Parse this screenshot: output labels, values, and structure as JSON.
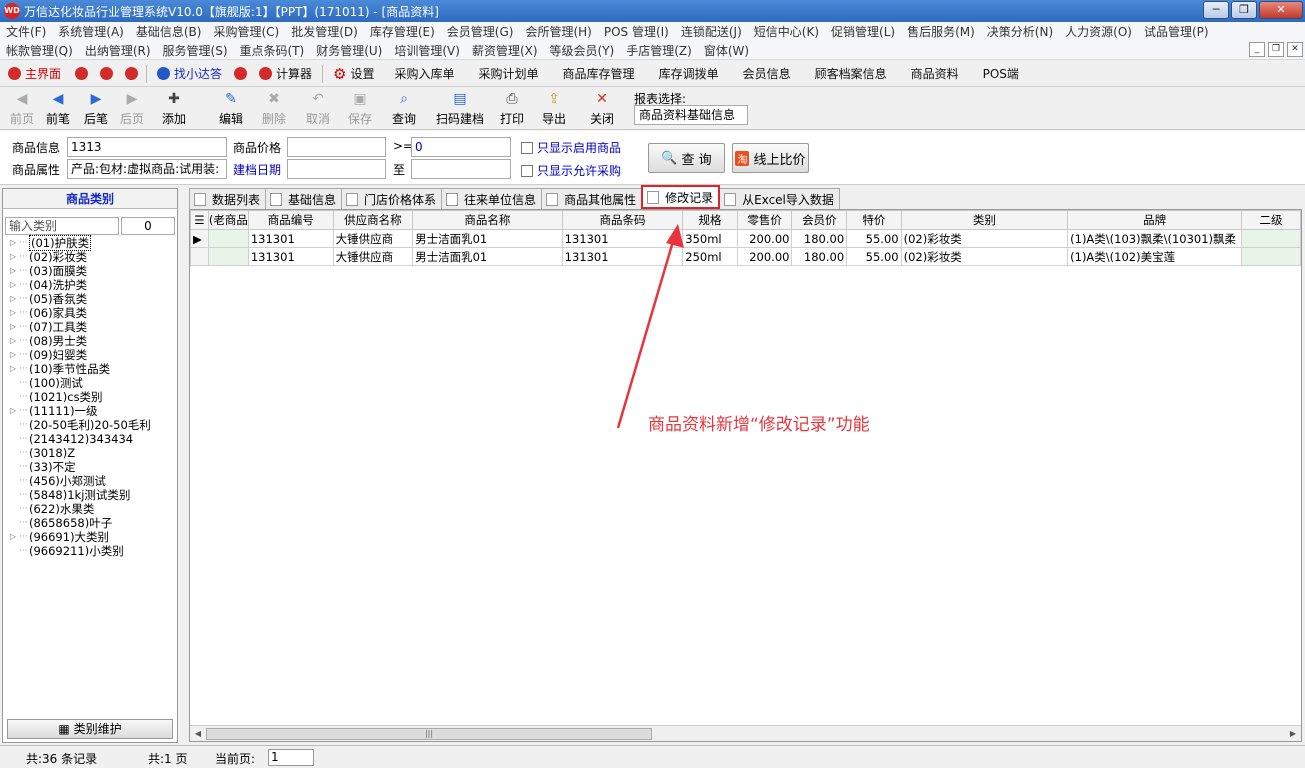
{
  "window": {
    "title": "万信达化妆品行业管理系统V10.0【旗舰版:1】【PPT】(171011) - [商品资料]",
    "logo_text": "WD"
  },
  "menu": {
    "row1": [
      "文件(F)",
      "系统管理(A)",
      "基础信息(B)",
      "采购管理(C)",
      "批发管理(D)",
      "库存管理(E)",
      "会员管理(G)",
      "会所管理(H)",
      "POS 管理(I)",
      "连锁配送(J)",
      "短信中心(K)",
      "促销管理(L)",
      "售后服务(M)",
      "决策分析(N)",
      "人力资源(O)",
      "试品管理(P)"
    ],
    "row2": [
      "帐款管理(Q)",
      "出纳管理(R)",
      "服务管理(S)",
      "重点条码(T)",
      "财务管理(U)",
      "培训管理(V)",
      "薪资管理(X)",
      "等级会员(Y)",
      "手店管理(Z)",
      "窗体(W)"
    ]
  },
  "quickbar": {
    "main": "主界面",
    "find": "找小达答",
    "calc": "计算器",
    "settings": "设置",
    "links": [
      "采购入库单",
      "采购计划单",
      "商品库存管理",
      "库存调拨单",
      "会员信息",
      "顾客档案信息",
      "商品资料",
      "POS端"
    ]
  },
  "toolbar": {
    "buttons": [
      {
        "label": "前页",
        "disabled": true
      },
      {
        "label": "前笔",
        "disabled": false
      },
      {
        "label": "后笔",
        "disabled": false
      },
      {
        "label": "后页",
        "disabled": true
      },
      {
        "label": "添加",
        "disabled": false
      },
      {
        "label": "编辑",
        "disabled": false
      },
      {
        "label": "删除",
        "disabled": true
      },
      {
        "label": "取消",
        "disabled": true
      },
      {
        "label": "保存",
        "disabled": true
      },
      {
        "label": "查询",
        "disabled": false
      },
      {
        "label": "扫码建档",
        "disabled": false
      },
      {
        "label": "打印",
        "disabled": false
      },
      {
        "label": "导出",
        "disabled": false
      },
      {
        "label": "关闭",
        "disabled": false
      }
    ],
    "report_label": "报表选择:",
    "report_value": "商品资料基础信息"
  },
  "filter": {
    "product_info_label": "商品信息",
    "product_info_value": "1313",
    "product_attr_label": "商品属性",
    "product_attr_value": "产品:包材:虚拟商品:试用装:",
    "price_label": "商品价格",
    "price_op": ">=",
    "price_value": "0",
    "date_label": "建档日期",
    "date_to": "至",
    "only_enabled": "只显示启用商品",
    "only_purchase": "只显示允许采购",
    "query_btn": "查  询",
    "compare_btn": "线上比价",
    "compare_icon_text": "淘"
  },
  "category_panel": {
    "title": "商品类别",
    "input_placeholder": "输入类别",
    "count": "0",
    "items": [
      {
        "text": "(01)护肤类",
        "expandable": true,
        "selected": true
      },
      {
        "text": "(02)彩妆类",
        "expandable": true
      },
      {
        "text": "(03)面膜类",
        "expandable": true
      },
      {
        "text": "(04)洗护类",
        "expandable": true
      },
      {
        "text": "(05)香氛类",
        "expandable": true
      },
      {
        "text": "(06)家具类",
        "expandable": true
      },
      {
        "text": "(07)工具类",
        "expandable": true
      },
      {
        "text": "(08)男士类",
        "expandable": true
      },
      {
        "text": "(09)妇婴类",
        "expandable": true
      },
      {
        "text": "(10)季节性品类",
        "expandable": true
      },
      {
        "text": "(100)测试",
        "expandable": false
      },
      {
        "text": "(1021)cs类别",
        "expandable": false
      },
      {
        "text": "(11111)一级",
        "expandable": true
      },
      {
        "text": "(20-50毛利)20-50毛利",
        "expandable": false
      },
      {
        "text": "(2143412)343434",
        "expandable": false
      },
      {
        "text": "(3018)Z",
        "expandable": false
      },
      {
        "text": "(33)不定",
        "expandable": false
      },
      {
        "text": "(456)小郑测试",
        "expandable": false
      },
      {
        "text": "(5848)1kj测试类别",
        "expandable": false
      },
      {
        "text": "(622)水果类",
        "expandable": false
      },
      {
        "text": "(8658658)叶子",
        "expandable": false
      },
      {
        "text": "(96691)大类别",
        "expandable": true
      },
      {
        "text": "(9669211)小类别",
        "expandable": false
      }
    ],
    "maintain_btn": "类别维护"
  },
  "tabs": [
    "数据列表",
    "基础信息",
    "门店价格体系",
    "往来单位信息",
    "商品其他属性",
    "修改记录",
    "从Excel导入数据"
  ],
  "active_tab": 5,
  "grid": {
    "columns": [
      "",
      "(老商品",
      "商品编号",
      "供应商名称",
      "商品名称",
      "商品条码",
      "规格",
      "零售价",
      "会员价",
      "特价",
      "类别",
      "品牌",
      "二级"
    ],
    "rows": [
      [
        "▶",
        "",
        "131301",
        "大锤供应商",
        "男士洁面乳01",
        "131301",
        "350ml",
        "200.00",
        "180.00",
        "55.00",
        "(02)彩妆类",
        "(1)A类\\(103)飘柔\\(10301)飘柔",
        ""
      ],
      [
        "",
        "",
        "131301",
        "大锤供应商",
        "男士洁面乳01",
        "131301",
        "250ml",
        "200.00",
        "180.00",
        "55.00",
        "(02)彩妆类",
        "(1)A类\\(102)美宝莲",
        ""
      ]
    ]
  },
  "status": {
    "records": "共:36 条记录",
    "pages": "共:1 页",
    "current_label": "当前页:",
    "current_value": "1"
  },
  "annotation": "商品资料新增“修改记录”功能",
  "colors": {
    "annotation": "#e8353d",
    "accent": "#1428c8"
  }
}
